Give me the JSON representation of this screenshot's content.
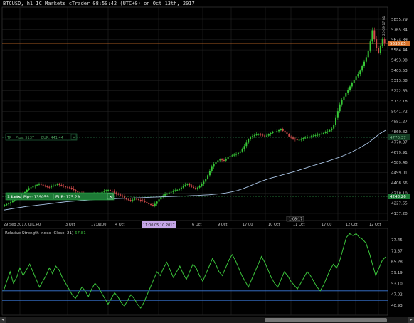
{
  "window": {
    "title": "BTCUSD, h1 IC Markets cTrader 08:50:42 (UTC+0) on Oct 13th, 2017"
  },
  "colors": {
    "background": "#000000",
    "grid": "#262626",
    "bull": "#37c837",
    "bear": "#d24b4b",
    "ma": "#a9c4e4",
    "rsi": "#3bc53b",
    "rsi_levels": "#3a78d8",
    "bid_line": "#d8742c",
    "position_line": "#2c9a46",
    "target_line": "#2a7a4a"
  },
  "price_axis": {
    "labels": [
      "5855.79",
      "5765.34",
      "5674.89",
      "5584.44",
      "5493.98",
      "5403.53",
      "5313.08",
      "5222.63",
      "5132.18",
      "5041.72",
      "4951.27",
      "4860.82",
      "4770.37",
      "4679.91",
      "4589.46",
      "4499.01",
      "4408.56",
      "4318.10",
      "4227.65",
      "4137.20"
    ],
    "current_price": "5638.85",
    "position_price": "4248.26",
    "target_price": "4770.37",
    "vertical_caption": "20:09:17 h1"
  },
  "time_axis": {
    "labels": [
      "29 Sep 2017, UTC+0",
      "17:00",
      "3 Oct",
      "17:00",
      "4 Oct",
      "6 Oct",
      "9 Oct",
      "17:00",
      "10 Oct",
      "11 Oct",
      "17:00",
      "12 Oct",
      "12 Oct"
    ],
    "crosshair_label": "11:00 05.10.2017",
    "countdown_label": "1:08:17"
  },
  "position_bar": {
    "lots": "1 Lots",
    "pips": "Pips: 139059",
    "eur": "EUR: 175.29",
    "close_glyph": "×"
  },
  "target_bar": {
    "tp_label": "TP",
    "pips": "Pips: 5137",
    "eur": "EUR: 441.44",
    "close_glyph": "×"
  },
  "rsi": {
    "label": "Relative Strength Index (Close, 21)",
    "value": "67.81",
    "axis_labels": [
      "77.45",
      "71.37",
      "65.28",
      "59.19",
      "53.10",
      "47.02",
      "40.93"
    ]
  },
  "scrollbar": {
    "left_glyph": "◂",
    "right_glyph": "▸"
  },
  "chart_data": {
    "type": "candlestick",
    "symbol": "BTCUSD",
    "timeframe": "h1",
    "ylim": [
      4090,
      5900
    ],
    "closes": [
      4165,
      4172,
      4178,
      4190,
      4205,
      4222,
      4240,
      4258,
      4268,
      4262,
      4280,
      4300,
      4315,
      4322,
      4330,
      4338,
      4345,
      4352,
      4346,
      4338,
      4330,
      4326,
      4322,
      4330,
      4338,
      4345,
      4350,
      4343,
      4336,
      4330,
      4326,
      4322,
      4318,
      4310,
      4298,
      4286,
      4278,
      4270,
      4266,
      4262,
      4256,
      4248,
      4244,
      4252,
      4262,
      4266,
      4270,
      4275,
      4282,
      4290,
      4296,
      4298,
      4292,
      4284,
      4276,
      4266,
      4258,
      4250,
      4240,
      4225,
      4215,
      4210,
      4205,
      4212,
      4220,
      4216,
      4210,
      4205,
      4200,
      4192,
      4180,
      4172,
      4166,
      4160,
      4175,
      4195,
      4215,
      4235,
      4250,
      4260,
      4268,
      4276,
      4282,
      4288,
      4296,
      4300,
      4306,
      4320,
      4335,
      4344,
      4352,
      4340,
      4326,
      4318,
      4312,
      4320,
      4334,
      4352,
      4372,
      4400,
      4430,
      4470,
      4505,
      4530,
      4550,
      4562,
      4570,
      4565,
      4560,
      4574,
      4590,
      4600,
      4606,
      4612,
      4620,
      4630,
      4642,
      4660,
      4690,
      4720,
      4748,
      4768,
      4778,
      4786,
      4792,
      4796,
      4790,
      4783,
      4776,
      4782,
      4795,
      4805,
      4812,
      4818,
      4822,
      4830,
      4838,
      4825,
      4810,
      4795,
      4775,
      4764,
      4756,
      4748,
      4742,
      4745,
      4752,
      4760,
      4764,
      4768,
      4773,
      4778,
      4782,
      4786,
      4790,
      4795,
      4800,
      4805,
      4812,
      4820,
      4830,
      4845,
      4880,
      4940,
      5000,
      5060,
      5100,
      5130,
      5160,
      5190,
      5220,
      5250,
      5280,
      5310,
      5330,
      5360,
      5400,
      5440,
      5480,
      5540,
      5620,
      5720,
      5640,
      5560,
      5520,
      5580,
      5640,
      5600
    ],
    "moving_average": {
      "ylim": [
        4090,
        5900
      ],
      "values": [
        4120,
        4128,
        4136,
        4144,
        4152,
        4158,
        4164,
        4170,
        4176,
        4182,
        4188,
        4194,
        4198,
        4202,
        4206,
        4210,
        4213,
        4216,
        4218,
        4220,
        4222,
        4224,
        4226,
        4228,
        4230,
        4232,
        4234,
        4236,
        4238,
        4240,
        4242,
        4244,
        4246,
        4248,
        4250,
        4253,
        4256,
        4260,
        4265,
        4272,
        4282,
        4294,
        4310,
        4330,
        4352,
        4372,
        4390,
        4406,
        4420,
        4434,
        4448,
        4462,
        4478,
        4494,
        4510,
        4526,
        4542,
        4558,
        4574,
        4592,
        4612,
        4634,
        4660,
        4688,
        4720,
        4760,
        4800,
        4830
      ]
    },
    "rsi": {
      "ylim": [
        38,
        82
      ],
      "levels": [
        50,
        45
      ],
      "values": [
        50,
        55,
        60,
        54,
        57,
        62,
        58,
        61,
        64,
        60,
        56,
        52,
        55,
        58,
        62,
        59,
        63,
        61,
        57,
        54,
        51,
        48,
        46,
        49,
        52,
        50,
        47,
        51,
        54,
        52,
        49,
        46,
        43,
        46,
        49,
        47,
        44,
        42,
        45,
        48,
        46,
        43,
        41,
        44,
        48,
        52,
        56,
        60,
        58,
        62,
        65,
        61,
        57,
        60,
        63,
        59,
        56,
        60,
        64,
        62,
        58,
        55,
        59,
        63,
        67,
        64,
        60,
        58,
        62,
        66,
        69,
        66,
        62,
        58,
        55,
        52,
        56,
        60,
        64,
        68,
        65,
        61,
        57,
        54,
        52,
        56,
        60,
        58,
        55,
        53,
        51,
        54,
        57,
        60,
        58,
        55,
        52,
        50,
        53,
        57,
        61,
        64,
        62,
        66,
        72,
        78,
        80,
        79,
        80,
        78,
        77,
        75,
        70,
        64,
        58,
        62,
        66,
        67.8
      ]
    }
  }
}
